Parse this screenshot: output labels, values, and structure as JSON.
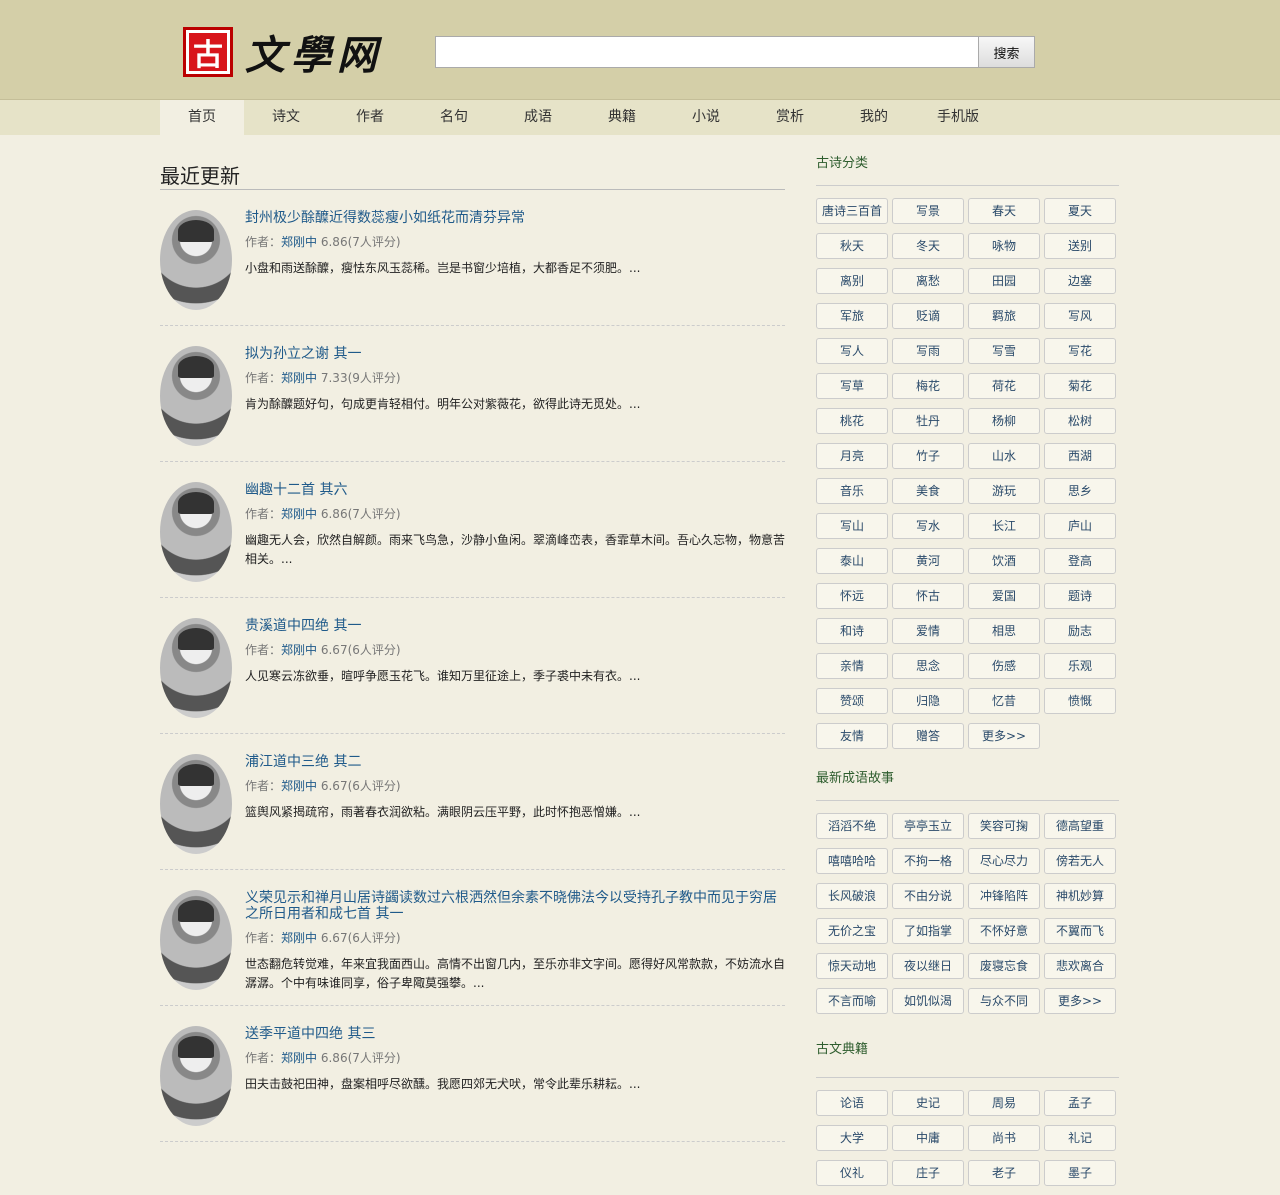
{
  "header": {
    "logo_seal": "古",
    "logo_name": "文學网",
    "search_placeholder": "",
    "search_button": "搜索"
  },
  "nav": [
    "首页",
    "诗文",
    "作者",
    "名句",
    "成语",
    "典籍",
    "小说",
    "赏析",
    "我的",
    "手机版"
  ],
  "main": {
    "title": "最近更新",
    "author_prefix": "作者：",
    "poems": [
      {
        "title": "封州极少酴醾近得数蕊瘦小如纸花而清芬异常",
        "author": "郑刚中",
        "rating": "6.86(7人评分)",
        "excerpt": "小盘和雨送酴醾，瘦怯东风玉蕊稀。岂是书窗少培植，大都香足不须肥。..."
      },
      {
        "title": "拟为孙立之谢 其一",
        "author": "郑刚中",
        "rating": "7.33(9人评分)",
        "excerpt": "肯为酴醾题好句，句成更肯轻相付。明年公对紫薇花，欲得此诗无觅处。..."
      },
      {
        "title": "幽趣十二首 其六",
        "author": "郑刚中",
        "rating": "6.86(7人评分)",
        "excerpt": "幽趣无人会，欣然自解颜。雨来飞鸟急，沙静小鱼闲。翠滴峰峦表，香霏草木间。吾心久忘物，物意苦相关。..."
      },
      {
        "title": "贵溪道中四绝 其一",
        "author": "郑刚中",
        "rating": "6.67(6人评分)",
        "excerpt": "人见寒云冻欲垂，暄呼争愿玉花飞。谁知万里征途上，季子裘中未有衣。..."
      },
      {
        "title": "浦江道中三绝 其二",
        "author": "郑刚中",
        "rating": "6.67(6人评分)",
        "excerpt": "篮舆风紧揭疏帘，雨著春衣润欲粘。满眼阴云压平野，此时怀抱恶憎嫌。..."
      },
      {
        "title": "义荣见示和禅月山居诗蠲读数过六根洒然但余素不晓佛法今以受持孔子教中而见于穷居之所日用者和成七首 其一",
        "author": "郑刚中",
        "rating": "6.67(6人评分)",
        "excerpt": "世态翻危转觉难，年来宜我面西山。高情不出窗几内，至乐亦非文字间。愿得好风常款款，不妨流水自潺潺。个中有味谁同享，俗子卑陬莫强攀。..."
      },
      {
        "title": "送季平道中四绝 其三",
        "author": "郑刚中",
        "rating": "6.86(7人评分)",
        "excerpt": "田夫击鼓祀田神，盘案相呼尽欲醺。我愿四郊无犬吠，常令此辈乐耕耘。..."
      }
    ]
  },
  "sidebar": {
    "poem_categories": {
      "title": "古诗分类",
      "tags": [
        "唐诗三百首",
        "写景",
        "春天",
        "夏天",
        "秋天",
        "冬天",
        "咏物",
        "送别",
        "离别",
        "离愁",
        "田园",
        "边塞",
        "军旅",
        "贬谪",
        "羁旅",
        "写风",
        "写人",
        "写雨",
        "写雪",
        "写花",
        "写草",
        "梅花",
        "荷花",
        "菊花",
        "桃花",
        "牡丹",
        "杨柳",
        "松树",
        "月亮",
        "竹子",
        "山水",
        "西湖",
        "音乐",
        "美食",
        "游玩",
        "思乡",
        "写山",
        "写水",
        "长江",
        "庐山",
        "泰山",
        "黄河",
        "饮酒",
        "登高",
        "怀远",
        "怀古",
        "爱国",
        "题诗",
        "和诗",
        "爱情",
        "相思",
        "励志",
        "亲情",
        "思念",
        "伤感",
        "乐观",
        "赞颂",
        "归隐",
        "忆昔",
        "愤慨",
        "友情",
        "赠答",
        "更多>>"
      ]
    },
    "idioms": {
      "title": "最新成语故事",
      "tags": [
        "滔滔不绝",
        "亭亭玉立",
        "笑容可掬",
        "德高望重",
        "嘻嘻哈哈",
        "不拘一格",
        "尽心尽力",
        "傍若无人",
        "长风破浪",
        "不由分说",
        "冲锋陷阵",
        "神机妙算",
        "无价之宝",
        "了如指掌",
        "不怀好意",
        "不翼而飞",
        "惊天动地",
        "夜以继日",
        "废寝忘食",
        "悲欢离合",
        "不言而喻",
        "如饥似渴",
        "与众不同",
        "更多>>"
      ]
    },
    "classics": {
      "title": "古文典籍",
      "tags": [
        "论语",
        "史记",
        "周易",
        "孟子",
        "大学",
        "中庸",
        "尚书",
        "礼记",
        "仪礼",
        "庄子",
        "老子",
        "墨子"
      ]
    }
  }
}
